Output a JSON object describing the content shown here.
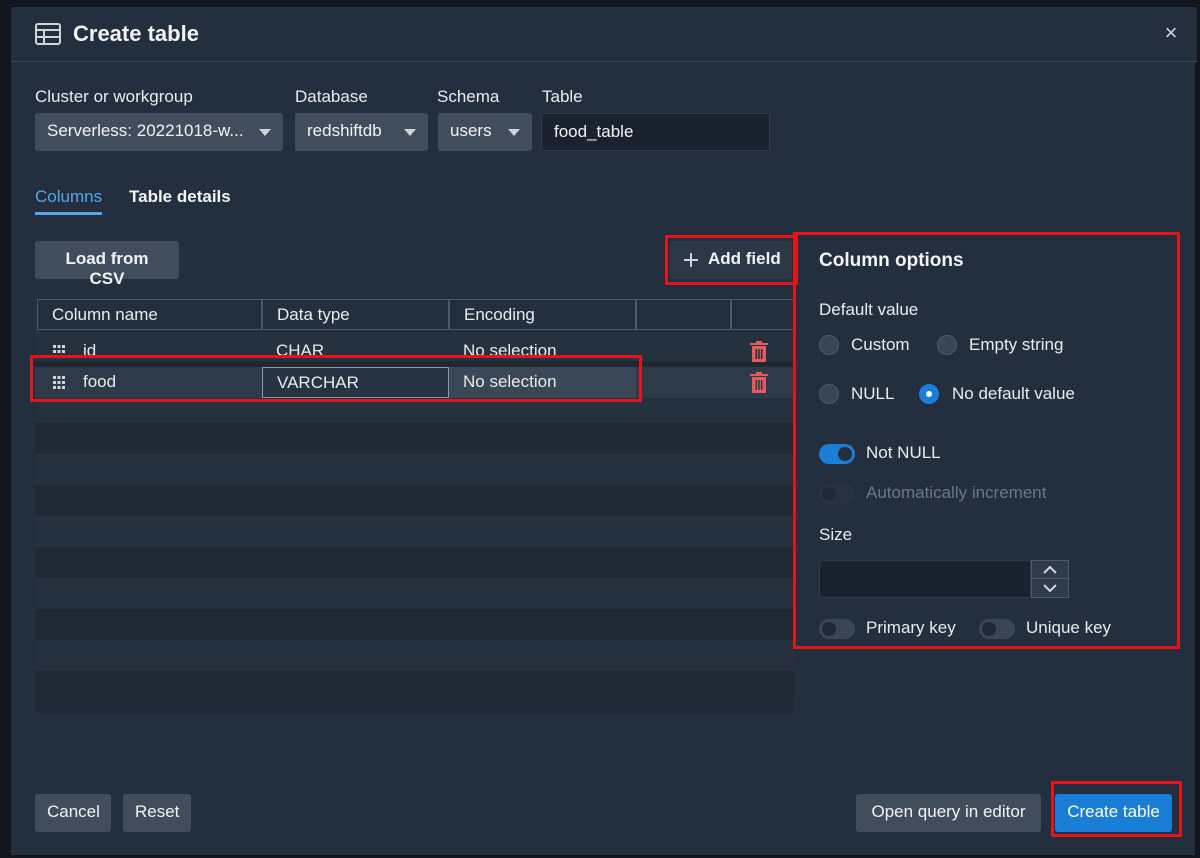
{
  "dialog": {
    "title": "Create table",
    "title_icon": "table-icon",
    "close_glyph": "×"
  },
  "fields": {
    "cluster": {
      "label": "Cluster or workgroup",
      "value": "Serverless: 20221018-w..."
    },
    "database": {
      "label": "Database",
      "value": "redshiftdb"
    },
    "schema": {
      "label": "Schema",
      "value": "users"
    },
    "table": {
      "label": "Table",
      "value": "food_table"
    }
  },
  "tabs": [
    {
      "label": "Columns",
      "active": true
    },
    {
      "label": "Table details",
      "active": false
    }
  ],
  "toolbar": {
    "load_csv_label": "Load from CSV",
    "add_field_label": "Add field",
    "add_field_icon": "plus-icon"
  },
  "grid": {
    "headers": [
      "Column name",
      "Data type",
      "Encoding"
    ],
    "rows": [
      {
        "name": "id",
        "type": "CHAR",
        "encoding": "No selection"
      },
      {
        "name": "food",
        "type": "VARCHAR",
        "encoding": "No selection",
        "selected": true
      }
    ]
  },
  "column_options": {
    "title": "Column options",
    "default_value_label": "Default value",
    "radios": [
      {
        "label": "Custom",
        "checked": false
      },
      {
        "label": "Empty string",
        "checked": false
      },
      {
        "label": "NULL",
        "checked": false
      },
      {
        "label": "No default value",
        "checked": true
      }
    ],
    "not_null": {
      "label": "Not NULL",
      "on": true
    },
    "auto_increment": {
      "label": "Automatically increment",
      "on": false,
      "disabled": true
    },
    "size_label": "Size",
    "size_value": "",
    "primary_key": {
      "label": "Primary key",
      "on": false
    },
    "unique_key": {
      "label": "Unique key",
      "on": false
    }
  },
  "footer": {
    "cancel_label": "Cancel",
    "reset_label": "Reset",
    "open_query_label": "Open query in editor",
    "create_label": "Create table"
  },
  "colors": {
    "accent": "#1b7ed6",
    "tab_active": "#54a6e8",
    "highlight_box": "#e3151a",
    "delete_icon": "#e35c5c"
  }
}
